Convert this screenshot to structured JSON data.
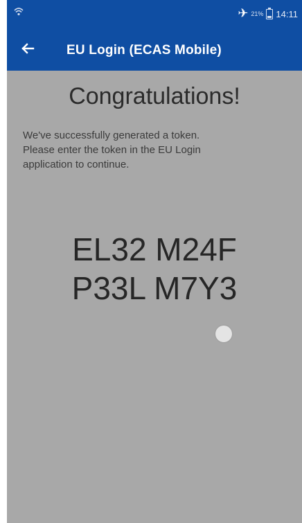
{
  "status_bar": {
    "battery_percent": "21%",
    "time": "14:11",
    "icons": [
      "signal-icon",
      "airplane-icon",
      "battery-icon"
    ]
  },
  "app_bar": {
    "title": "EU Login (ECAS Mobile)",
    "back_icon": "back-arrow-icon"
  },
  "content": {
    "heading": "Congratulations!",
    "message_lines": [
      "We've successfully generated a token.",
      "Please enter the token in the EU Login",
      "application to continue."
    ],
    "token_lines": [
      "EL32 M24F",
      "P33L M7Y3"
    ]
  },
  "colors": {
    "primary": "#0f4ea3",
    "content_background": "#a8a8a8",
    "text_dark": "#262626"
  }
}
